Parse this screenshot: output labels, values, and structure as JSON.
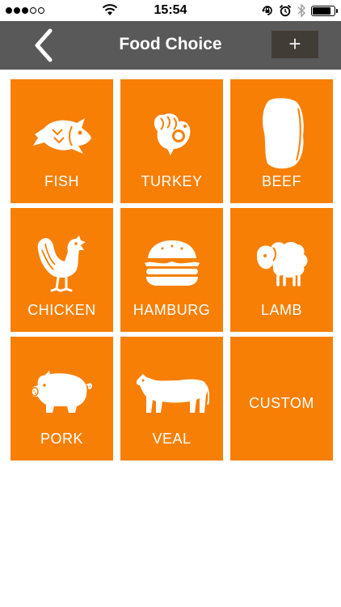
{
  "status_bar": {
    "time": "15:54"
  },
  "nav": {
    "title": "Food Choice",
    "add_label": "+"
  },
  "colors": {
    "accent": "#f77f05",
    "nav_bar": "#595959",
    "add_button": "#423c37"
  },
  "tiles": [
    {
      "label": "FISH",
      "icon": "fish-icon"
    },
    {
      "label": "TURKEY",
      "icon": "turkey-icon"
    },
    {
      "label": "BEEF",
      "icon": "beef-icon"
    },
    {
      "label": "CHICKEN",
      "icon": "rooster-icon"
    },
    {
      "label": "HAMBURG",
      "icon": "hamburger-icon"
    },
    {
      "label": "LAMB",
      "icon": "sheep-icon"
    },
    {
      "label": "PORK",
      "icon": "pig-icon"
    },
    {
      "label": "VEAL",
      "icon": "calf-icon"
    },
    {
      "label": "CUSTOM",
      "icon": ""
    }
  ]
}
